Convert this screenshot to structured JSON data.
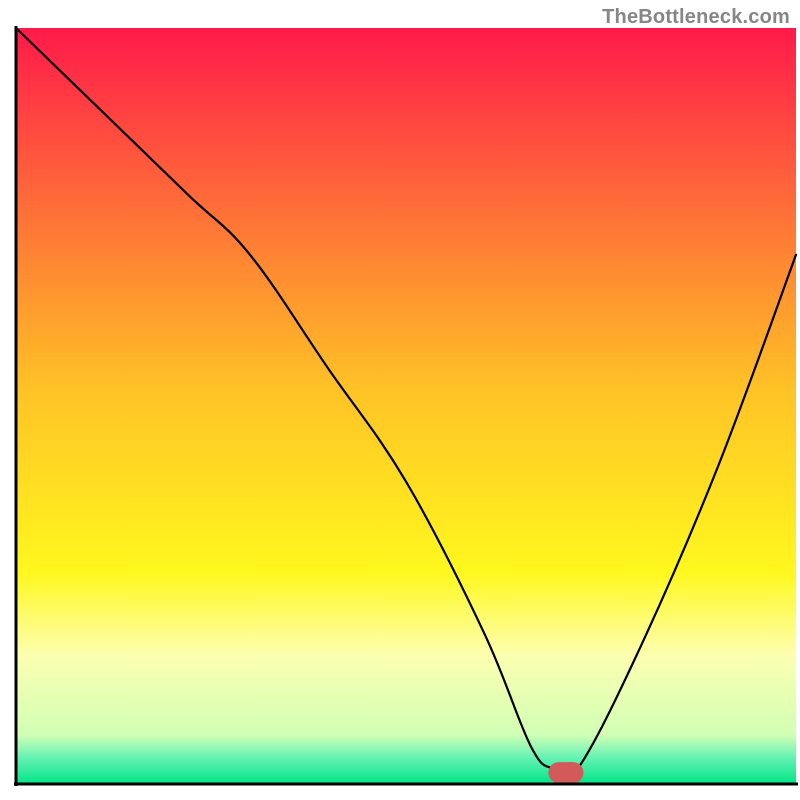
{
  "watermark": "TheBottleneck.com",
  "chart_data": {
    "type": "line",
    "title": "",
    "xlabel": "",
    "ylabel": "",
    "xlim": [
      0,
      100
    ],
    "ylim": [
      0,
      100
    ],
    "grid": false,
    "legend": false,
    "background_gradient": [
      {
        "pos": 0.0,
        "color": "#ff1a4a"
      },
      {
        "pos": 0.48,
        "color": "#ffc326"
      },
      {
        "pos": 0.72,
        "color": "#fff81e"
      },
      {
        "pos": 0.83,
        "color": "#fdffb0"
      },
      {
        "pos": 0.935,
        "color": "#d1ffb5"
      },
      {
        "pos": 0.965,
        "color": "#66f2b3"
      },
      {
        "pos": 1.0,
        "color": "#00e588"
      }
    ],
    "series": [
      {
        "name": "bottleneck-curve",
        "color": "#000000",
        "x": [
          0,
          10,
          22,
          30,
          40,
          50,
          60,
          66,
          69,
          72,
          80,
          90,
          100
        ],
        "y": [
          100,
          90,
          78,
          70,
          55,
          40,
          20,
          5,
          2,
          2,
          18,
          42,
          70
        ]
      }
    ],
    "marker": {
      "name": "optimal-point",
      "x": 70.5,
      "y": 1.5,
      "color": "#d45a5a",
      "width": 4.5,
      "height": 2.8,
      "rx": 1.4
    },
    "axes": {
      "stroke": "#000000",
      "stroke_width": 3
    }
  }
}
